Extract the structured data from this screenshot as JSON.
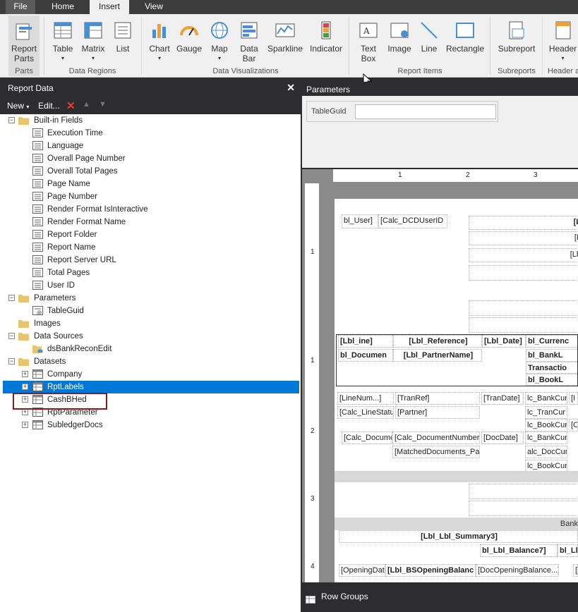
{
  "tabs": {
    "file": "File",
    "home": "Home",
    "insert": "Insert",
    "view": "View"
  },
  "ribbon": {
    "buttons": {
      "report_parts": "Report Parts",
      "table": "Table",
      "matrix": "Matrix",
      "list": "List",
      "chart": "Chart",
      "gauge": "Gauge",
      "map": "Map",
      "data_bar": "Data Bar",
      "sparkline": "Sparkline",
      "indicator": "Indicator",
      "text_box": "Text Box",
      "image": "Image",
      "line": "Line",
      "rectangle": "Rectangle",
      "subreport": "Subreport",
      "header": "Header"
    },
    "groups": {
      "parts": "Parts",
      "data_regions": "Data Regions",
      "data_viz": "Data Visualizations",
      "report_items": "Report Items",
      "subreports": "Subreports",
      "header_footer": "Header a"
    }
  },
  "report_data": {
    "title": "Report Data",
    "new": "New",
    "edit": "Edit...",
    "built_in": "Built-in Fields",
    "fields": [
      "Execution Time",
      "Language",
      "Overall Page Number",
      "Overall Total Pages",
      "Page Name",
      "Page Number",
      "Render Format IsInteractive",
      "Render Format Name",
      "Report Folder",
      "Report Name",
      "Report Server URL",
      "Total Pages",
      "User ID"
    ],
    "parameters": "Parameters",
    "param_items": [
      "TableGuid"
    ],
    "images": "Images",
    "data_sources": "Data Sources",
    "source_items": [
      "dsBankReconEdit"
    ],
    "datasets": "Datasets",
    "dataset_items": [
      "Company",
      "RptLabels",
      "CashBHed",
      "RptParameter",
      "SubledgerDocs"
    ]
  },
  "parameters_pane": {
    "title": "Parameters",
    "field_label": "TableGuid",
    "field_value": ""
  },
  "ruler": {
    "t1": "1",
    "t2": "2",
    "t3": "3",
    "l1": "1",
    "l2": "1",
    "l3": "2",
    "l4": "3",
    "l5": "4"
  },
  "report": {
    "c1": "bl_User]",
    "c2": "[Calc_DCDUserID",
    "c3": "[L",
    "c4": "[L",
    "c5": "[Lb",
    "c6": "[",
    "c7": "[",
    "h1": "[Lbl_ine]",
    "h2": "[Lbl_Reference]",
    "h3": "[Lbl_Date]",
    "h4": "bl_Currenc",
    "h5": "bl_Documen",
    "h6": "[Lbl_PartnerName]",
    "h7": "bl_BankL",
    "h8": "Transactio",
    "h9": "bl_BookL",
    "d1": "[LineNum...]",
    "d2": "[TranRef]",
    "d3": "[TranDate]",
    "d4": "lc_BankCur",
    "d4b": "[I",
    "d5": "[Calc_LineStatu",
    "d6": "[Partner]",
    "d7": "lc_TranCur",
    "d8": "lc_BookCur",
    "d8b": "[C",
    "e1": "[Calc_Docume",
    "e2": "[Calc_DocumentNumber]",
    "e3": "[DocDate]",
    "e4": "lc_BankCur",
    "e5": "[MatchedDocuments_Part",
    "e6": "alc_DocCur",
    "e7": "lc_BookCur",
    "f1": "[",
    "f2": "[",
    "bank": "Bank",
    "sum": "[Lbl_Lbl_Summary3]",
    "bal": "bl_Lbl_Balance7]",
    "bal2": "bl_Ll",
    "g1": "[OpeningDate",
    "g2": "[Lbl_BSOpeningBalanc",
    "g3": "[DocOpeningBalance...]",
    "g4": "["
  },
  "row_groups": "Row Groups"
}
